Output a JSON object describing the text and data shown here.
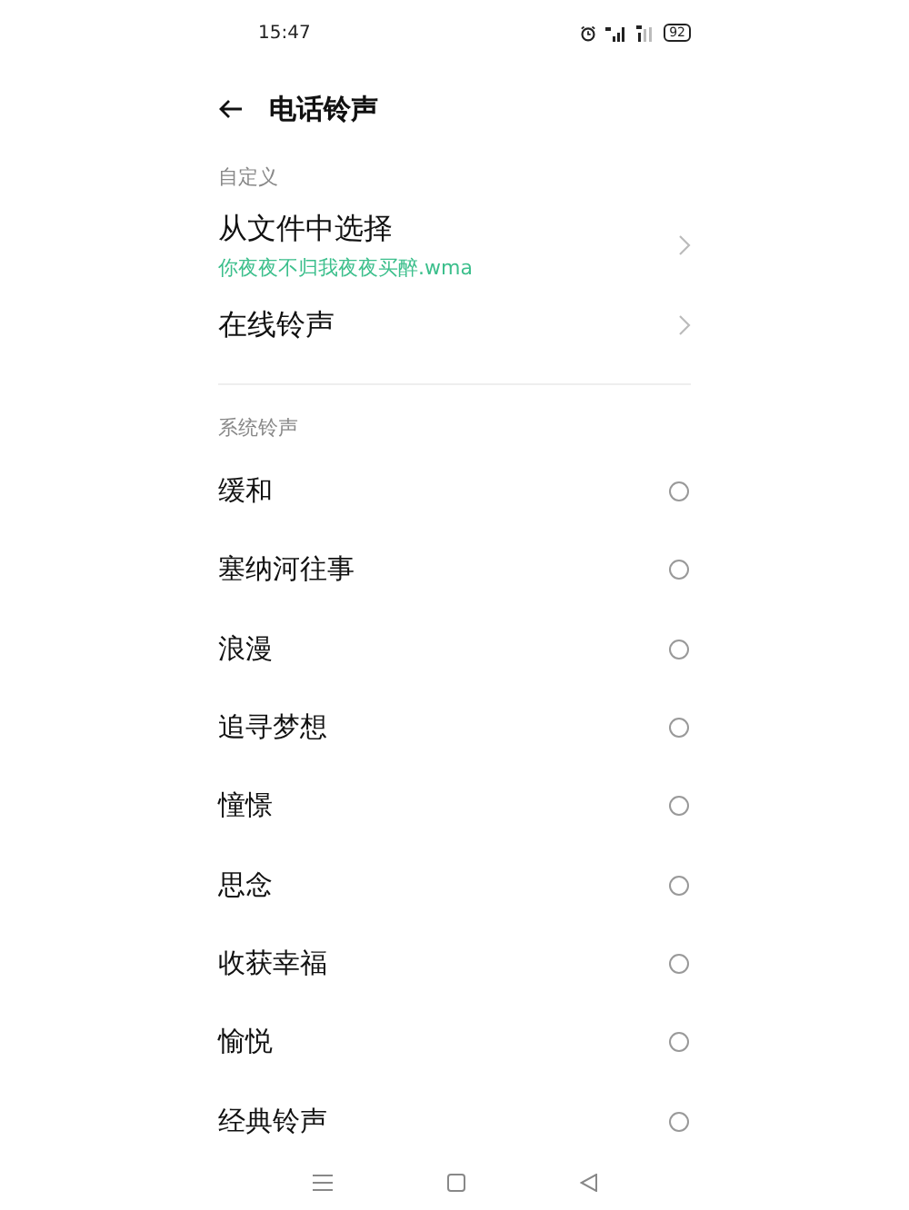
{
  "status_bar": {
    "time": "15:47",
    "battery": "92"
  },
  "header": {
    "title": "电话铃声"
  },
  "custom_section": {
    "title": "自定义",
    "items": [
      {
        "label": "从文件中选择",
        "subtitle": "你夜夜不归我夜夜买醉.wma"
      },
      {
        "label": "在线铃声"
      }
    ]
  },
  "system_section": {
    "title": "系统铃声",
    "items": [
      {
        "label": "缓和",
        "selected": false
      },
      {
        "label": "塞纳河往事",
        "selected": false
      },
      {
        "label": "浪漫",
        "selected": false
      },
      {
        "label": "追寻梦想",
        "selected": false
      },
      {
        "label": "憧憬",
        "selected": false
      },
      {
        "label": "思念",
        "selected": false
      },
      {
        "label": "收获幸福",
        "selected": false
      },
      {
        "label": "愉悦",
        "selected": false
      },
      {
        "label": "经典铃声",
        "selected": false
      }
    ]
  }
}
